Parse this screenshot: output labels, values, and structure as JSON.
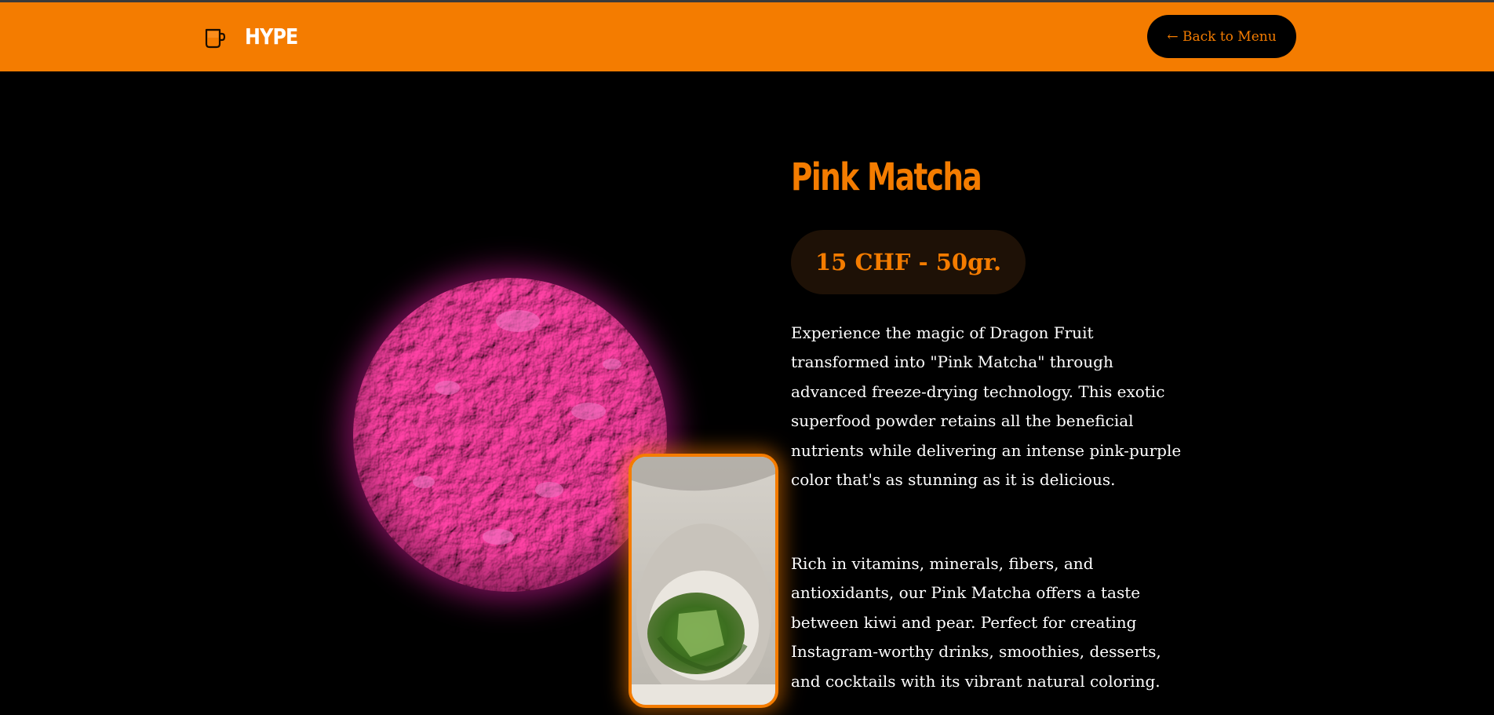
{
  "nav": {
    "brand": "HYPE",
    "back_label": "← Back to Menu"
  },
  "product": {
    "title": "Pink Matcha",
    "price": "15 CHF - 50gr.",
    "description": [
      "Experience the magic of Dragon Fruit transformed into \"Pink Matcha\" through advanced freeze-drying technology. This exotic superfood powder retains all the beneficial nutrients while delivering an intense pink-purple color that's as stunning as it is delicious.",
      "Rich in vitamins, minerals, fibers, and antioxidants, our Pink Matcha offers a taste between kiwi and pear. Perfect for creating Instagram-worthy drinks, smoothies, desserts, and cocktails with its vibrant natural coloring."
    ]
  },
  "colors": {
    "accent": "#f47c00",
    "background": "#000000",
    "price_pill": "#1e1106",
    "powder": "#e0399f"
  },
  "icons": {
    "brand": "cup-icon"
  }
}
